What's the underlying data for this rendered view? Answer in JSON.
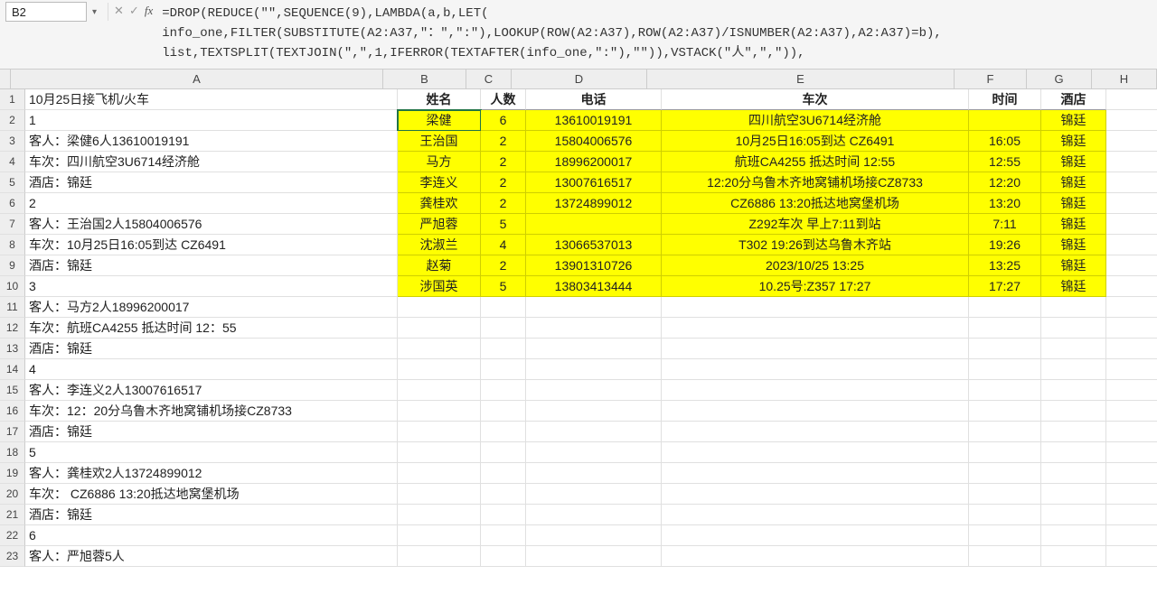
{
  "nameBox": "B2",
  "fx": {
    "cancel": "✕",
    "accept": "✓",
    "label": "fx"
  },
  "formulaLines": [
    "=DROP(REDUCE(\"\",SEQUENCE(9),LAMBDA(a,b,LET(",
    "info_one,FILTER(SUBSTITUTE(A2:A37,\"：\",\":\"),LOOKUP(ROW(A2:A37),ROW(A2:A37)/ISNUMBER(A2:A37),A2:A37)=b),",
    "list,TEXTSPLIT(TEXTJOIN(\",\",1,IFERROR(TEXTAFTER(info_one,\":\"),\"\")),VSTACK(\"人\",\",\")),"
  ],
  "colLetters": [
    "A",
    "B",
    "C",
    "D",
    "E",
    "F",
    "G",
    "H"
  ],
  "colA": [
    "10月25日接飞机/火车",
    "1",
    "客人：梁健6人13610019191",
    "车次：四川航空3U6714经济舱",
    "酒店：锦廷",
    "2",
    "客人：王治国2人15804006576",
    "车次：10月25日16:05到达  CZ6491",
    "酒店：锦廷",
    "3",
    "客人：马方2人18996200017",
    "车次：航班CA4255 抵达时间 12：55",
    "酒店：锦廷",
    "4",
    "客人：李连义2人13007616517",
    "车次：12：20分乌鲁木齐地窝铺机场接CZ8733",
    "酒店：锦廷",
    "5",
    "客人：龚桂欢2人13724899012",
    "车次： CZ6886   13:20抵达地窝堡机场",
    "酒店：锦廷",
    "6",
    "客人：严旭蓉5人"
  ],
  "tableHeader": {
    "b": "姓名",
    "c": "人数",
    "d": "电话",
    "e": "车次",
    "f": "时间",
    "g": "酒店"
  },
  "tableRows": [
    {
      "b": "梁健",
      "c": "6",
      "d": "13610019191",
      "e": "四川航空3U6714经济舱",
      "f": "",
      "g": "锦廷"
    },
    {
      "b": "王治国",
      "c": "2",
      "d": "15804006576",
      "e": "10月25日16:05到达  CZ6491",
      "f": "16:05",
      "g": "锦廷"
    },
    {
      "b": "马方",
      "c": "2",
      "d": "18996200017",
      "e": "航班CA4255 抵达时间 12:55",
      "f": "12:55",
      "g": "锦廷"
    },
    {
      "b": "李连义",
      "c": "2",
      "d": "13007616517",
      "e": "12:20分乌鲁木齐地窝铺机场接CZ8733",
      "f": "12:20",
      "g": "锦廷"
    },
    {
      "b": "龚桂欢",
      "c": "2",
      "d": "13724899012",
      "e": "CZ6886   13:20抵达地窝堡机场",
      "f": "13:20",
      "g": "锦廷"
    },
    {
      "b": "严旭蓉",
      "c": "5",
      "d": "",
      "e": "Z292车次    早上7:11到站",
      "f": "7:11",
      "g": "锦廷"
    },
    {
      "b": "沈淑兰",
      "c": "4",
      "d": "13066537013",
      "e": "T302 19:26到达乌鲁木齐站",
      "f": "19:26",
      "g": "锦廷"
    },
    {
      "b": "赵菊",
      "c": "2",
      "d": "13901310726",
      "e": "2023/10/25   13:25",
      "f": "13:25",
      "g": "锦廷"
    },
    {
      "b": "涉国英",
      "c": "5",
      "d": "13803413444",
      "e": "10.25号:Z357   17:27",
      "f": "17:27",
      "g": "锦廷"
    }
  ]
}
